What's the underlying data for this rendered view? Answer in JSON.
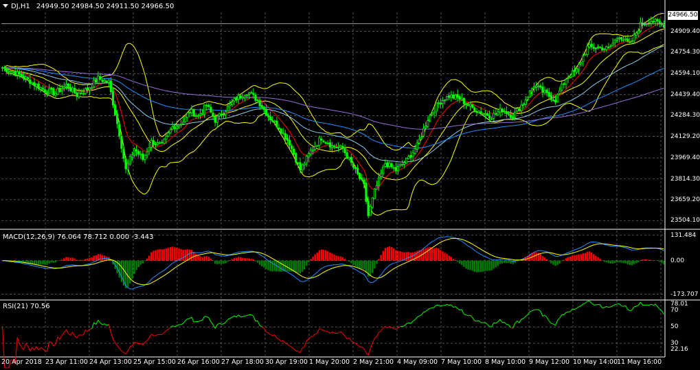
{
  "header": {
    "symbol": "DJ,H1",
    "ohlc": "24949.50 24984.50 24911.50 24966.50",
    "menu_icon": "triangle-down-icon"
  },
  "current_price": "24966.50",
  "colors": {
    "background": "#000000",
    "grid": "#8a8a8a",
    "bull": "#00ff00",
    "bear": "#00ff00",
    "bollinger": "#ffff00",
    "ma_fast": "#ff0000",
    "ma_mid": "#1e90ff",
    "ma_slow": "#87ceeb",
    "ma_200": "#9370db",
    "macd_line": "#1e90ff",
    "macd_signal": "#ffff00",
    "hist_up": "#ff0000",
    "hist_down": "#008000",
    "rsi": "#ff0000",
    "rsi_above": "#00ff00"
  },
  "chart_data": [
    {
      "type": "candlestick",
      "name": "main",
      "ylim": [
        23450,
        25050
      ],
      "y_ticks": [
        "24909.40",
        "24754.30",
        "24594.10",
        "24439.40",
        "24284.30",
        "24129.20",
        "23969.40",
        "23814.30",
        "23659.20",
        "23504.10"
      ],
      "y_tick_values": [
        24909.4,
        24754.3,
        24594.1,
        24439.4,
        24284.3,
        24129.2,
        23969.4,
        23814.3,
        23659.2,
        23504.1
      ],
      "x_ticks": [
        "20 Apr 2018",
        "23 Apr 11:00",
        "24 Apr 13:00",
        "25 Apr 15:00",
        "26 Apr 16:00",
        "27 Apr 18:00",
        "30 Apr 19:00",
        "1 May 20:00",
        "2 May 21:00",
        "4 May 09:00",
        "7 May 10:00",
        "8 May 10:00",
        "9 May 12:00",
        "10 May 14:00",
        "11 May 16:00"
      ],
      "price_keypoints": [
        [
          0,
          24640
        ],
        [
          5,
          24610
        ],
        [
          10,
          24570
        ],
        [
          15,
          24520
        ],
        [
          20,
          24470
        ],
        [
          25,
          24450
        ],
        [
          30,
          24510
        ],
        [
          35,
          24440
        ],
        [
          40,
          24480
        ],
        [
          45,
          24560
        ],
        [
          50,
          24530
        ],
        [
          55,
          24150
        ],
        [
          58,
          23880
        ],
        [
          62,
          24040
        ],
        [
          66,
          23960
        ],
        [
          70,
          24090
        ],
        [
          75,
          24060
        ],
        [
          80,
          24200
        ],
        [
          85,
          24240
        ],
        [
          88,
          24320
        ],
        [
          92,
          24280
        ],
        [
          96,
          24360
        ],
        [
          100,
          24250
        ],
        [
          105,
          24330
        ],
        [
          110,
          24410
        ],
        [
          115,
          24460
        ],
        [
          120,
          24400
        ],
        [
          125,
          24280
        ],
        [
          130,
          24200
        ],
        [
          135,
          24080
        ],
        [
          140,
          23880
        ],
        [
          145,
          24020
        ],
        [
          150,
          24120
        ],
        [
          155,
          24060
        ],
        [
          160,
          24040
        ],
        [
          165,
          23900
        ],
        [
          170,
          23760
        ],
        [
          172,
          23540
        ],
        [
          175,
          23720
        ],
        [
          180,
          23930
        ],
        [
          185,
          23880
        ],
        [
          190,
          23950
        ],
        [
          195,
          24060
        ],
        [
          200,
          24260
        ],
        [
          205,
          24380
        ],
        [
          210,
          24430
        ],
        [
          215,
          24410
        ],
        [
          220,
          24350
        ],
        [
          225,
          24310
        ],
        [
          230,
          24280
        ],
        [
          235,
          24330
        ],
        [
          240,
          24280
        ],
        [
          245,
          24380
        ],
        [
          250,
          24510
        ],
        [
          255,
          24450
        ],
        [
          260,
          24400
        ],
        [
          265,
          24560
        ],
        [
          270,
          24620
        ],
        [
          275,
          24790
        ],
        [
          280,
          24790
        ],
        [
          285,
          24780
        ],
        [
          290,
          24880
        ],
        [
          295,
          24810
        ],
        [
          300,
          24960
        ],
        [
          305,
          24990
        ],
        [
          310,
          24960
        ]
      ]
    },
    {
      "type": "histogram",
      "name": "MACD(12,26,9)",
      "label": "MACD(12,26,9) 76.064 78.712 0.000 -3.443",
      "ylim": [
        -200,
        155
      ],
      "y_ticks": [
        "131.484",
        "0.00",
        "-173.707"
      ],
      "y_tick_values": [
        131.484,
        0,
        -173.707
      ]
    },
    {
      "type": "line",
      "name": "RSI(21)",
      "label": "RSI(21) 70.56",
      "ylim": [
        15,
        82
      ],
      "y_ticks": [
        "78.01",
        "70",
        "50",
        "30",
        "22.16"
      ],
      "y_tick_values": [
        78.01,
        70,
        50,
        30,
        22.16
      ],
      "levels": [
        70,
        30
      ]
    }
  ]
}
